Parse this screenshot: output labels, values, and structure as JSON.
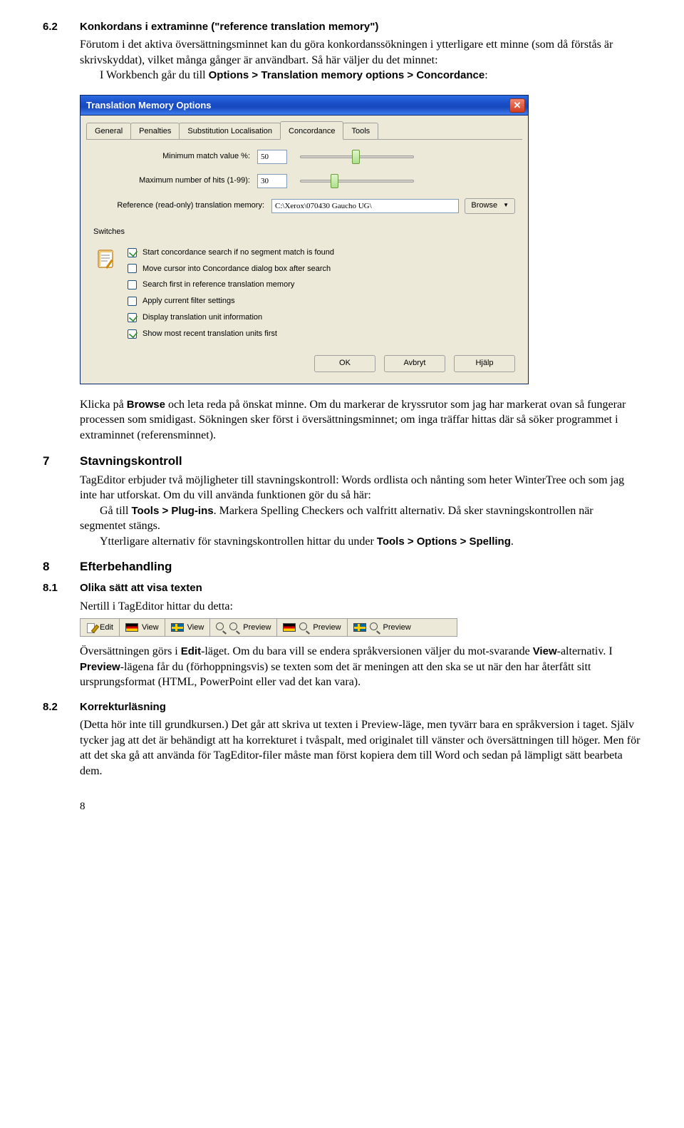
{
  "section_6_2": {
    "num": "6.2",
    "title": "Konkordans i extraminne (\"reference translation memory\")",
    "p1": "Förutom i det aktiva översättningsminnet kan du göra konkordanssökningen i ytterligare ett minne (som då förstås är skrivskyddat), vilket många gånger är användbart. Så här väljer du det minnet:",
    "p2_a": "I Workbench går du till ",
    "p2_b": "Options > Translation memory options > Concordance",
    "p2_c": ":"
  },
  "dialog": {
    "title": "Translation Memory Options",
    "tabs": [
      "General",
      "Penalties",
      "Substitution Localisation",
      "Concordance",
      "Tools"
    ],
    "min_match_label": "Minimum match value %:",
    "min_match_value": "50",
    "max_hits_label": "Maximum number of hits (1-99):",
    "max_hits_value": "30",
    "ref_label": "Reference (read-only) translation memory:",
    "ref_value": "C:\\Xerox\\070430 Gaucho UG\\",
    "browse_label": "Browse",
    "switches_title": "Switches",
    "switches": [
      {
        "checked": true,
        "label": "Start concordance search if no segment match is found"
      },
      {
        "checked": false,
        "label": "Move cursor into Concordance dialog box after search"
      },
      {
        "checked": false,
        "label": "Search first in reference translation memory"
      },
      {
        "checked": false,
        "label": "Apply current filter settings"
      },
      {
        "checked": true,
        "label": "Display translation unit information"
      },
      {
        "checked": true,
        "label": "Show most recent translation units first"
      }
    ],
    "buttons": {
      "ok": "OK",
      "cancel": "Avbryt",
      "help": "Hjälp"
    }
  },
  "after_dialog": {
    "p1_a": "Klicka på ",
    "p1_b": "Browse",
    "p1_c": " och leta reda på önskat minne. Om du markerar de kryssrutor som jag har markerat ovan så fungerar processen som smidigast. Sökningen sker först i översättningsminnet; om inga träffar hittas där så söker programmet i extraminnet (referensminnet)."
  },
  "section_7": {
    "num": "7",
    "title": "Stavningskontroll",
    "p1": "TagEditor erbjuder två möjligheter till stavningskontroll: Words ordlista och nånting som heter WinterTree och som jag inte har utforskat. Om du vill använda funktionen gör du så här:",
    "p2_a": "Gå till ",
    "p2_b": "Tools > Plug-ins",
    "p2_c": ". Markera Spelling Checkers och valfritt alternativ. Då sker stavningskontrollen när segmentet stängs.",
    "p3_a": "Ytterligare alternativ för stavningskontrollen hittar du under ",
    "p3_b": "Tools > Options > Spelling",
    "p3_c": "."
  },
  "section_8": {
    "num": "8",
    "title": "Efterbehandling"
  },
  "section_8_1": {
    "num": "8.1",
    "title": "Olika sätt att visa texten",
    "p1": "Nertill i TagEditor hittar du detta:"
  },
  "te_toolbar": {
    "tabs": [
      "Edit",
      "View",
      "View",
      "Preview",
      "Preview",
      "Preview"
    ]
  },
  "after_toolbar": {
    "p1_a": "Översättningen görs i ",
    "p1_b": "Edit",
    "p1_c": "-läget. Om du bara vill se endera språkversionen väljer du mot-svarande ",
    "p1_d": "View",
    "p1_e": "-alternativ. I ",
    "p1_f": "Preview",
    "p1_g": "-lägena får du (förhoppningsvis) se texten som det är meningen att den ska se ut när den har återfått sitt ursprungsformat (HTML, PowerPoint eller vad det kan vara)."
  },
  "section_8_2": {
    "num": "8.2",
    "title": "Korrekturläsning",
    "p1": "(Detta hör inte till grundkursen.) Det går att skriva ut texten i Preview-läge, men tyvärr bara en språkversion i taget. Själv tycker jag att det är behändigt att ha korrekturet i tvåspalt, med originalet till vänster och översättningen till höger. Men för att det ska gå att använda för TagEditor-filer måste man först kopiera dem till Word och sedan på lämpligt sätt bearbeta dem."
  },
  "page_number": "8"
}
